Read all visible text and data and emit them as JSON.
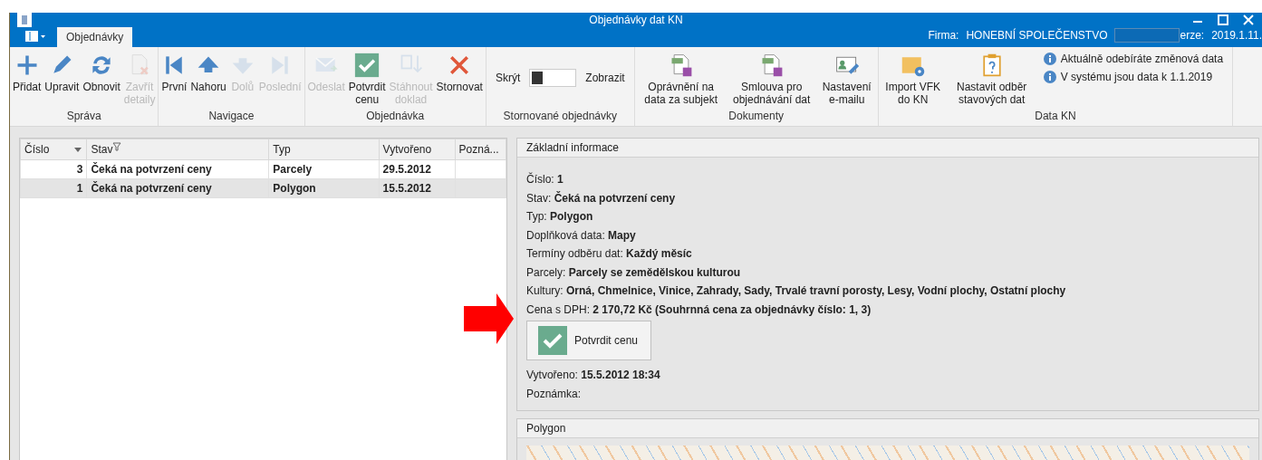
{
  "window": {
    "title": "Objednávky dat KN"
  },
  "tabs": [
    {
      "label": "Objednávky",
      "selected": true
    }
  ],
  "company": {
    "label": "Firma:",
    "value": "HONEBNÍ SPOLEČENSTVO",
    "version_label": "erze:",
    "version": "2019.1.11."
  },
  "ribbon": {
    "groups": [
      {
        "label": "Správa",
        "buttons": [
          {
            "label": "Přidat",
            "disabled": false
          },
          {
            "label": "Upravit",
            "disabled": false
          },
          {
            "label": "Obnovit",
            "disabled": false
          },
          {
            "label": "Zavřít detaily",
            "disabled": true
          }
        ]
      },
      {
        "label": "Navigace",
        "buttons": [
          {
            "label": "První",
            "disabled": false
          },
          {
            "label": "Nahoru",
            "disabled": false
          },
          {
            "label": "Dolů",
            "disabled": true
          },
          {
            "label": "Poslední",
            "disabled": true
          }
        ]
      },
      {
        "label": "Objednávka",
        "buttons": [
          {
            "label": "Odeslat",
            "disabled": true
          },
          {
            "label": "Potvrdit cenu",
            "disabled": false
          },
          {
            "label": "Stáhnout doklad",
            "disabled": true
          },
          {
            "label": "Stornovat",
            "disabled": false
          }
        ]
      },
      {
        "label": "Stornované objednávky",
        "toggle": {
          "off_label": "Skrýt",
          "on_label": "Zobrazit",
          "on": false
        }
      },
      {
        "label": "Dokumenty",
        "buttons": [
          {
            "label": "Oprávnění na data za subjekt",
            "disabled": false
          },
          {
            "label": "Smlouva pro objednávání dat",
            "disabled": false
          },
          {
            "label": "Nastavení e-mailu",
            "disabled": false
          }
        ]
      },
      {
        "label": "Data KN",
        "buttons": [
          {
            "label": "Import VFK do KN",
            "disabled": false
          },
          {
            "label": "Nastavit odběr stavových dat",
            "disabled": false
          }
        ],
        "info": [
          "Aktuálně odebíráte změnová data",
          "V systému jsou data k 1.1.2019"
        ]
      }
    ]
  },
  "table": {
    "columns": [
      "Číslo",
      "Stav",
      "Typ",
      "Vytvořeno",
      "Pozná..."
    ],
    "rows": [
      {
        "cells": [
          "3",
          "Čeká na potvrzení ceny",
          "Parcely",
          "29.5.2012",
          ""
        ],
        "selected": false
      },
      {
        "cells": [
          "1",
          "Čeká na potvrzení ceny",
          "Polygon",
          "15.5.2012",
          ""
        ],
        "selected": true
      }
    ]
  },
  "details": {
    "title": "Základní informace",
    "lines": [
      "Číslo: **1**",
      "Stav: **Čeká na potvrzení ceny**",
      "Typ: **Polygon**",
      "Doplňková data: **Mapy**",
      "Termíny odběru dat: **Každý měsíc**",
      "Parcely: **Parcely se zemědělskou kulturou**",
      "Kultury: **Orná, Chmelnice, Vinice, Zahrady, Sady, Trvalé travní porosty, Lesy, Vodní plochy, Ostatní plochy**",
      "Cena s DPH: **2 170,72 Kč (Souhrnná cena za objednávky číslo: 1, 3)**"
    ],
    "button": "Potvrdit cenu",
    "after_lines": [
      "Vytvořeno: **15.5.2012 18:34**",
      "Poznámka:"
    ]
  },
  "polygon": {
    "title": "Polygon"
  }
}
